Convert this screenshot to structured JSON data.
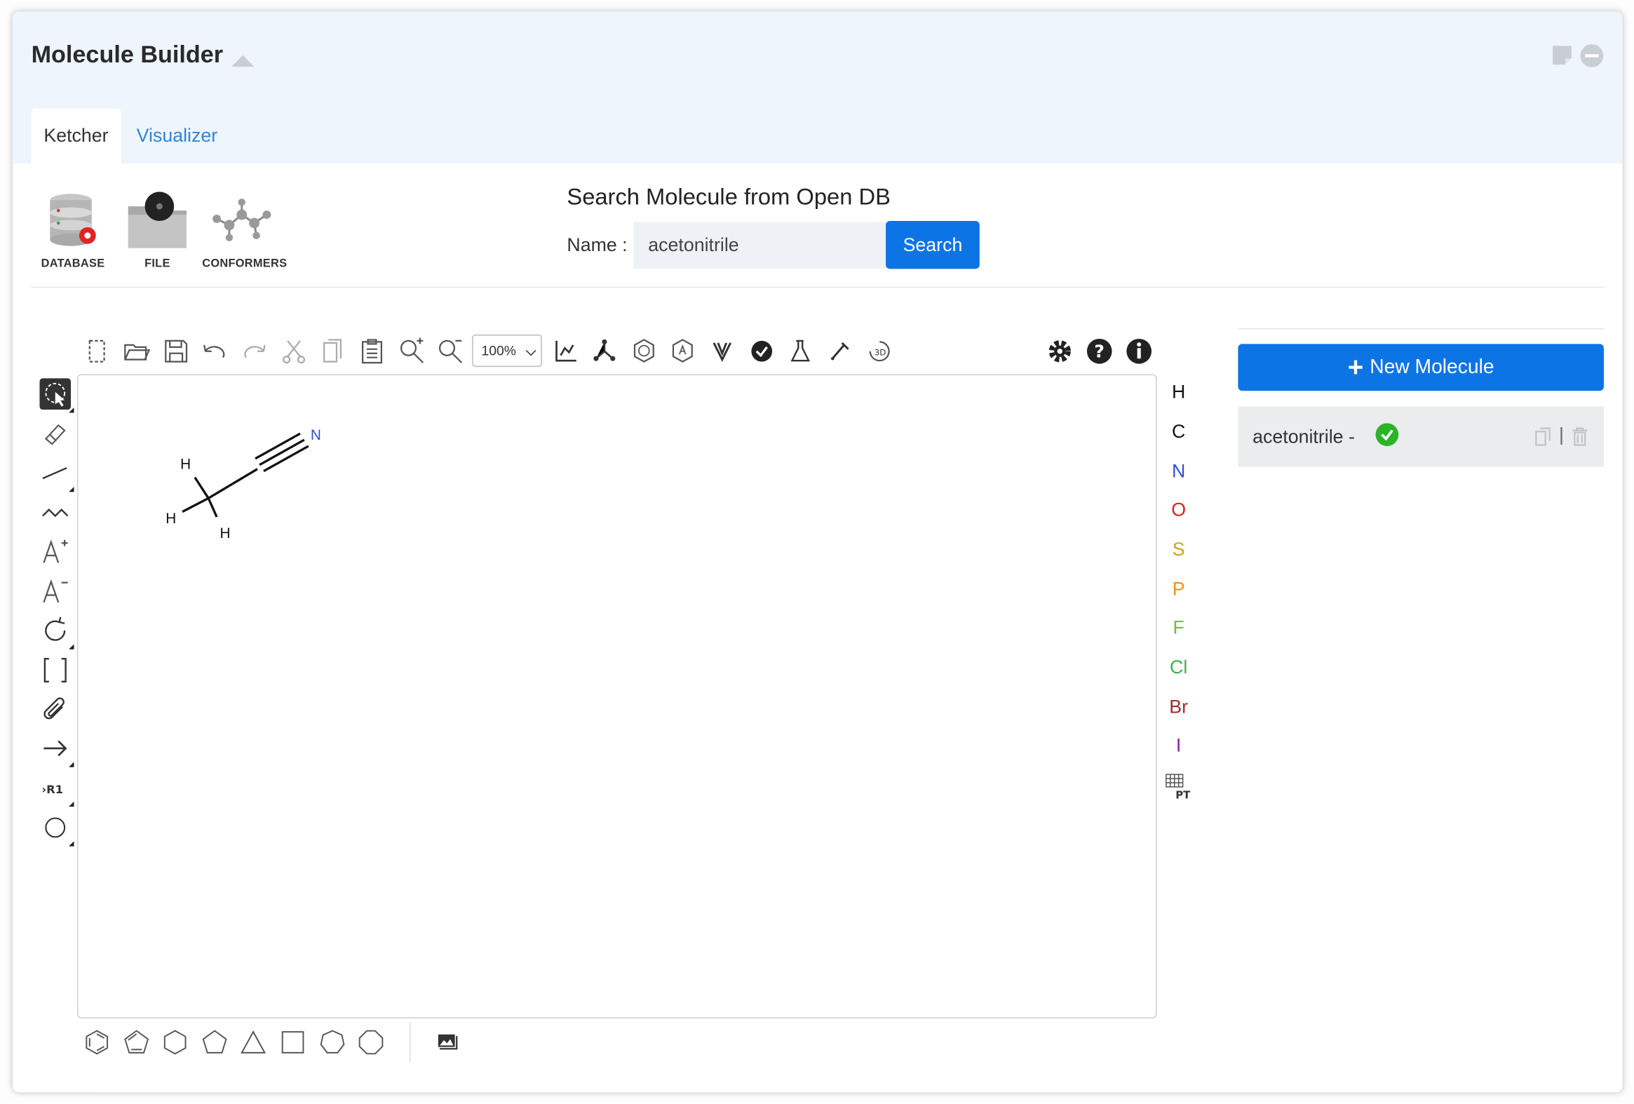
{
  "header": {
    "title": "Molecule Builder"
  },
  "tabs": [
    {
      "label": "Ketcher"
    },
    {
      "label": "Visualizer"
    }
  ],
  "tools": [
    {
      "label": "DATABASE",
      "icon": "database-icon"
    },
    {
      "label": "FILE",
      "icon": "file-icon"
    },
    {
      "label": "CONFORMERS",
      "icon": "conformers-icon"
    }
  ],
  "search": {
    "title": "Search Molecule from Open DB",
    "name_label": "Name :",
    "value": "acetonitrile",
    "button": "Search"
  },
  "editor": {
    "zoom": "100%",
    "atoms": [
      "H",
      "C",
      "N",
      "O",
      "S",
      "P",
      "F",
      "Cl",
      "Br",
      "I"
    ],
    "atom_colors": {
      "H": "#111111",
      "C": "#111111",
      "N": "#2f4fd8",
      "O": "#e0211d",
      "S": "#c9a227",
      "P": "#f08f1a",
      "F": "#7ab83f",
      "Cl": "#3bb34a",
      "Br": "#a52a2a",
      "I": "#8b1fa3"
    },
    "periodic_table_label": "PT",
    "molecule": {
      "nitrogen_label": "N",
      "hydrogen_labels": [
        "H",
        "H",
        "H"
      ]
    }
  },
  "sidebar": {
    "new_molecule": "New Molecule",
    "molecules": [
      {
        "name": "acetonitrile -"
      }
    ]
  },
  "colors": {
    "accent": "#0d74e6",
    "header_bg": "#eef5fd",
    "link": "#2f86d8",
    "success": "#2db32a"
  }
}
